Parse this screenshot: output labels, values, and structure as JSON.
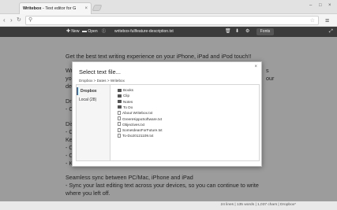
{
  "browser": {
    "tab_brand": "Writebox",
    "tab_title": " - Text editor for G",
    "tab_close": "×",
    "back": "‹",
    "forward": "›",
    "reload": "↻",
    "url": "",
    "menu_icon": "≡",
    "minimize": "–",
    "maximize": "□",
    "close": "×"
  },
  "toolbar": {
    "new_label": "New",
    "open_label": "Open",
    "filename": "writebox-fullfeature-description.txt",
    "fonts_label": "Fonts",
    "icons": [
      "plus-icon",
      "folder-icon",
      "info-icon",
      "trash-icon",
      "download-icon",
      "gear-icon",
      "fullscreen-icon"
    ]
  },
  "document": {
    "lines": [
      "Get the best text writing experience on your iPhone, iPad and iPod touch!!",
      "Writ",
      "you",
      "devi",
      "Drop",
      "- Op",
      "Disti",
      "- Cu",
      "Keyt",
      "- Op",
      "- Ch",
      "- Ke",
      "Seamless sync between PC/Mac, iPhone and iPad",
      "- Sync your last editing text across your devices, so you can continue to write",
      "where you left off."
    ],
    "right_fragments": [
      "s",
      "our"
    ]
  },
  "status": {
    "text": "24 lines | 135 words | 1,037 chars | Dropbox*"
  },
  "dialog": {
    "title": "Select text file...",
    "close_label": "×",
    "breadcrumb": "Dropbox > Dates > Writebox",
    "sources": [
      {
        "label": "Dropbox",
        "active": true
      },
      {
        "label": "Local (28)",
        "active": false
      }
    ],
    "files": [
      {
        "name": "Books",
        "type": "folder"
      },
      {
        "name": "Clip",
        "type": "folder"
      },
      {
        "name": "Notes",
        "type": "folder"
      },
      {
        "name": "To Do",
        "type": "folder"
      },
      {
        "name": "About Writebox.txt",
        "type": "file"
      },
      {
        "name": "GreenHippoSoftware.txt",
        "type": "file"
      },
      {
        "name": "Objectives.txt",
        "type": "file"
      },
      {
        "name": "SomeIdeasForFuture.txt",
        "type": "file"
      },
      {
        "name": "To-Do20121109.txt",
        "type": "file"
      }
    ]
  }
}
